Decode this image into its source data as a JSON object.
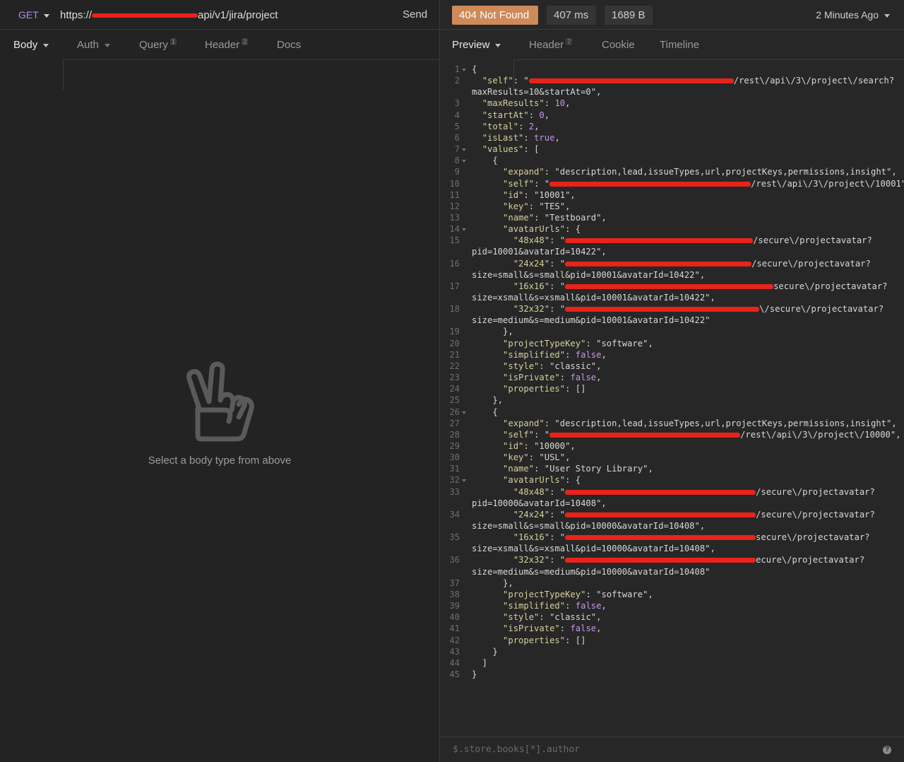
{
  "request": {
    "method": "GET",
    "url_prefix": "https://",
    "url_suffix": "api/v1/jira/project",
    "send_label": "Send",
    "tabs": [
      {
        "label": "Body",
        "badge": ""
      },
      {
        "label": "Auth",
        "badge": ""
      },
      {
        "label": "Query",
        "badge": "1"
      },
      {
        "label": "Header",
        "badge": "2"
      },
      {
        "label": "Docs",
        "badge": ""
      }
    ],
    "empty_message": "Select a body type from above"
  },
  "response": {
    "status": "404 Not Found",
    "time": "407 ms",
    "size": "1689 B",
    "ago": "2 Minutes Ago",
    "tabs": [
      {
        "label": "Preview",
        "badge": ""
      },
      {
        "label": "Header",
        "badge": "7"
      },
      {
        "label": "Cookie",
        "badge": ""
      },
      {
        "label": "Timeline",
        "badge": ""
      }
    ],
    "filter_placeholder": "$.store.books[*].author",
    "help_icon": "?"
  },
  "code_lines": [
    {
      "n": "1",
      "t": "{"
    },
    {
      "n": "2",
      "t": "  \"self\": \"[redacted]/rest\\/api\\/3\\/project\\/search?"
    },
    {
      "n": "",
      "t": "maxResults=10&startAt=0\","
    },
    {
      "n": "3",
      "t": "  \"maxResults\": 10,"
    },
    {
      "n": "4",
      "t": "  \"startAt\": 0,"
    },
    {
      "n": "5",
      "t": "  \"total\": 2,"
    },
    {
      "n": "6",
      "t": "  \"isLast\": true,"
    },
    {
      "n": "7",
      "t": "  \"values\": ["
    },
    {
      "n": "8",
      "t": "    {"
    },
    {
      "n": "9",
      "t": "      \"expand\": \"description,lead,issueTypes,url,projectKeys,permissions,insight\","
    },
    {
      "n": "10",
      "t": "      \"self\": \"[redacted]/rest\\/api\\/3\\/project\\/10001\","
    },
    {
      "n": "11",
      "t": "      \"id\": \"10001\","
    },
    {
      "n": "12",
      "t": "      \"key\": \"TES\","
    },
    {
      "n": "13",
      "t": "      \"name\": \"Testboard\","
    },
    {
      "n": "14",
      "t": "      \"avatarUrls\": {"
    },
    {
      "n": "15",
      "t": "        \"48x48\": \"[redacted]/secure\\/projectavatar?"
    },
    {
      "n": "",
      "t": "pid=10001&avatarId=10422\","
    },
    {
      "n": "16",
      "t": "        \"24x24\": \"[redacted]/secure\\/projectavatar?"
    },
    {
      "n": "",
      "t": "size=small&s=small&pid=10001&avatarId=10422\","
    },
    {
      "n": "17",
      "t": "        \"16x16\": \"[redacted]secure\\/projectavatar?"
    },
    {
      "n": "",
      "t": "size=xsmall&s=xsmall&pid=10001&avatarId=10422\","
    },
    {
      "n": "18",
      "t": "        \"32x32\": \"[redacted]\\/secure\\/projectavatar?"
    },
    {
      "n": "",
      "t": "size=medium&s=medium&pid=10001&avatarId=10422\""
    },
    {
      "n": "19",
      "t": "      },"
    },
    {
      "n": "20",
      "t": "      \"projectTypeKey\": \"software\","
    },
    {
      "n": "21",
      "t": "      \"simplified\": false,"
    },
    {
      "n": "22",
      "t": "      \"style\": \"classic\","
    },
    {
      "n": "23",
      "t": "      \"isPrivate\": false,"
    },
    {
      "n": "24",
      "t": "      \"properties\": []"
    },
    {
      "n": "25",
      "t": "    },"
    },
    {
      "n": "26",
      "t": "    {"
    },
    {
      "n": "27",
      "t": "      \"expand\": \"description,lead,issueTypes,url,projectKeys,permissions,insight\","
    },
    {
      "n": "28",
      "t": "      \"self\": \"[redacted]/rest\\/api\\/3\\/project\\/10000\","
    },
    {
      "n": "29",
      "t": "      \"id\": \"10000\","
    },
    {
      "n": "30",
      "t": "      \"key\": \"USL\","
    },
    {
      "n": "31",
      "t": "      \"name\": \"User Story Library\","
    },
    {
      "n": "32",
      "t": "      \"avatarUrls\": {"
    },
    {
      "n": "33",
      "t": "        \"48x48\": \"[redacted]/secure\\/projectavatar?"
    },
    {
      "n": "",
      "t": "pid=10000&avatarId=10408\","
    },
    {
      "n": "34",
      "t": "        \"24x24\": \"[redacted]/secure\\/projectavatar?"
    },
    {
      "n": "",
      "t": "size=small&s=small&pid=10000&avatarId=10408\","
    },
    {
      "n": "35",
      "t": "        \"16x16\": \"[redacted]secure\\/projectavatar?"
    },
    {
      "n": "",
      "t": "size=xsmall&s=xsmall&pid=10000&avatarId=10408\","
    },
    {
      "n": "36",
      "t": "        \"32x32\": \"[redacted]ecure\\/projectavatar?"
    },
    {
      "n": "",
      "t": "size=medium&s=medium&pid=10000&avatarId=10408\""
    },
    {
      "n": "37",
      "t": "      },"
    },
    {
      "n": "38",
      "t": "      \"projectTypeKey\": \"software\","
    },
    {
      "n": "39",
      "t": "      \"simplified\": false,"
    },
    {
      "n": "40",
      "t": "      \"style\": \"classic\","
    },
    {
      "n": "41",
      "t": "      \"isPrivate\": false,"
    },
    {
      "n": "42",
      "t": "      \"properties\": []"
    },
    {
      "n": "43",
      "t": "    }"
    },
    {
      "n": "44",
      "t": "  ]"
    },
    {
      "n": "45",
      "t": "}"
    }
  ],
  "folded_lines": [
    "1",
    "7",
    "8",
    "14",
    "26",
    "32"
  ],
  "colors": {
    "status_bg": "#cf8a5a",
    "keyword": "#c695e8",
    "string": "#d4cf9c",
    "method": "#b58be0",
    "redaction": "#e8231a"
  },
  "icons": {
    "empty_state": "peace-hand-icon",
    "method_dropdown": "chevron-down-icon",
    "help": "question-circle-icon"
  }
}
